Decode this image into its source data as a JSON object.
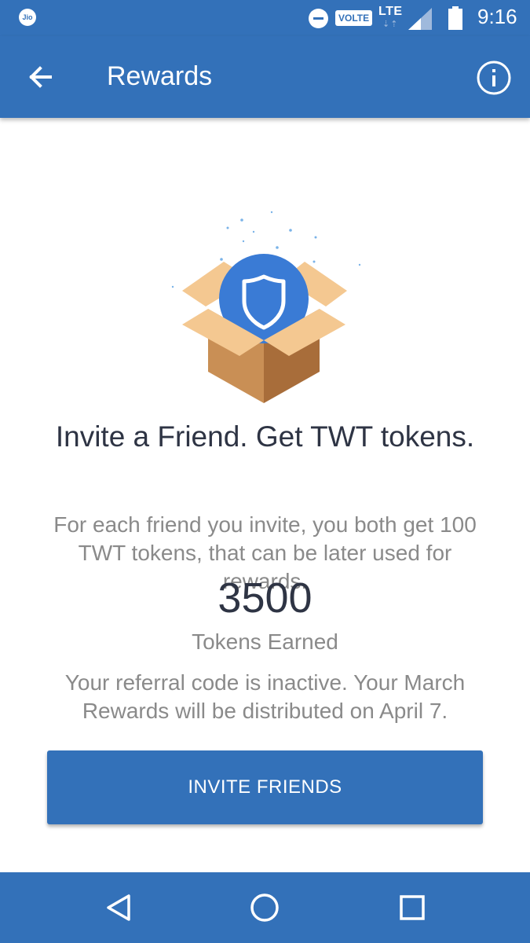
{
  "status_bar": {
    "carrier": "Jio",
    "volte": "VOLTE",
    "network": "LTE",
    "time": "9:16"
  },
  "app_bar": {
    "title": "Rewards"
  },
  "content": {
    "headline": "Invite a Friend. Get TWT tokens.",
    "description": "For each friend you invite, you both get 100 TWT tokens, that can be later used for rewards.",
    "tokens_value": "3500",
    "tokens_label": "Tokens Earned",
    "referral_status": "Your referral code is inactive. Your March Rewards will be distributed on April 7.",
    "invite_button": "INVITE FRIENDS"
  },
  "colors": {
    "primary": "#3371b9",
    "text_dark": "#2e3444",
    "text_muted": "#8a8a8a"
  },
  "icons": {
    "back": "arrow-left",
    "info": "info-circle",
    "illustration": "box-with-shield",
    "nav_back": "triangle-left",
    "nav_home": "circle",
    "nav_recents": "square"
  }
}
